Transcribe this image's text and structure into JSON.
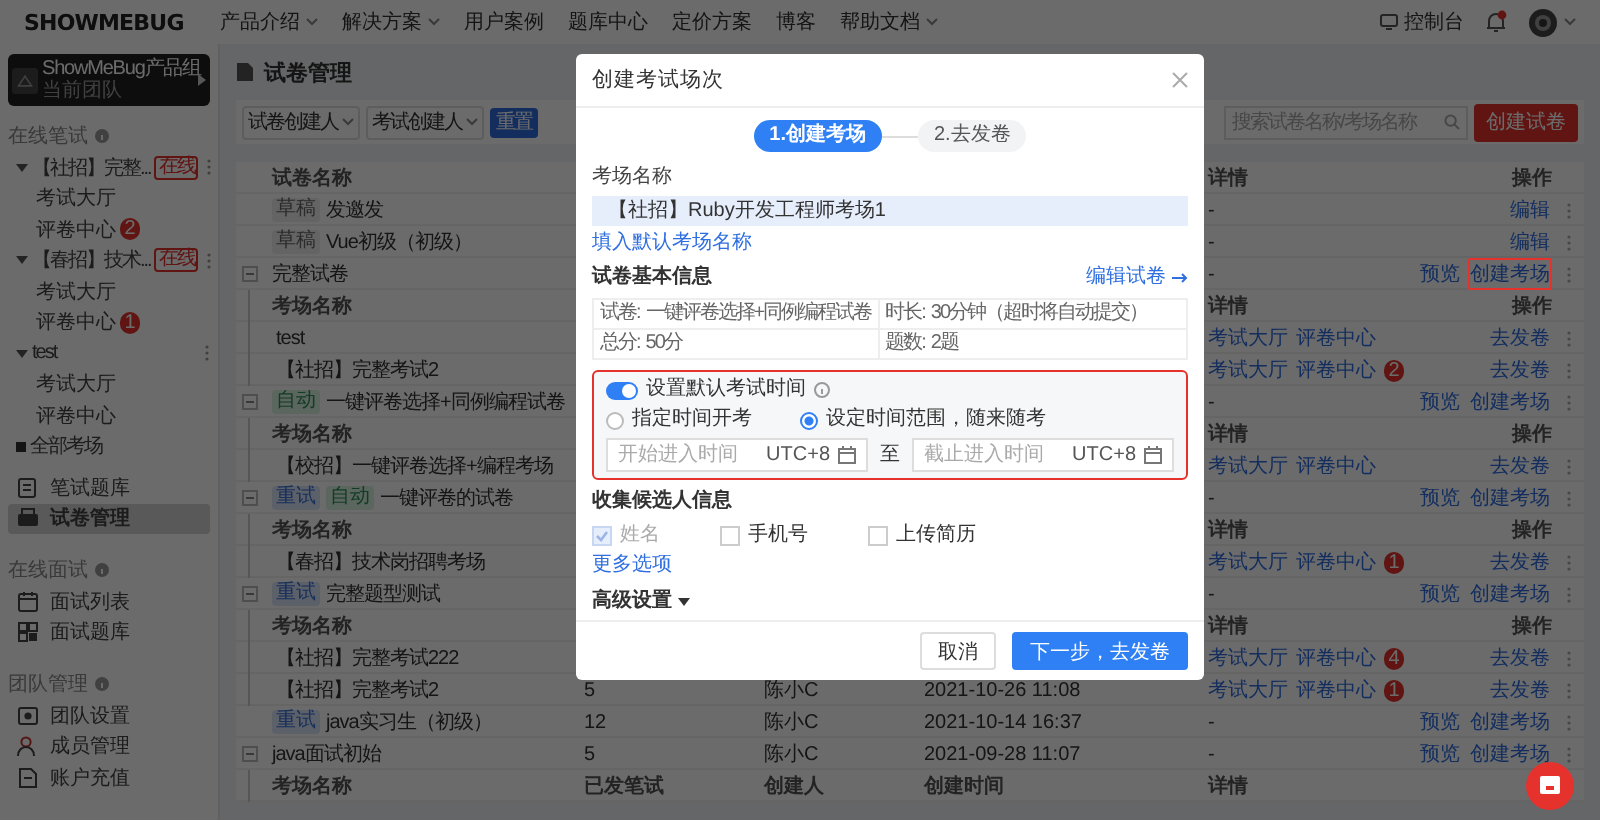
{
  "topbar": {
    "logo": "SHOWMEBUG",
    "nav": [
      {
        "label": "产品介绍",
        "dropdown": true
      },
      {
        "label": "解决方案",
        "dropdown": true
      },
      {
        "label": "用户案例",
        "dropdown": false
      },
      {
        "label": "题库中心",
        "dropdown": false
      },
      {
        "label": "定价方案",
        "dropdown": false
      },
      {
        "label": "博客",
        "dropdown": false
      },
      {
        "label": "帮助文档",
        "dropdown": true
      }
    ],
    "console": "控制台"
  },
  "sidebar": {
    "team": {
      "name": "ShowMeBug产品组",
      "subtitle": "当前团队"
    },
    "items": [
      {
        "kind": "heading",
        "label": "在线笔试"
      },
      {
        "kind": "group",
        "label": "【社招】完整...",
        "badge": "在线",
        "expanded": true,
        "children": [
          {
            "label": "考试大厅"
          },
          {
            "label": "评卷中心",
            "count": "2"
          }
        ]
      },
      {
        "kind": "group",
        "label": "【春招】技术...",
        "badge": "在线",
        "expanded": true,
        "children": [
          {
            "label": "考试大厅"
          },
          {
            "label": "评卷中心",
            "count": "1"
          }
        ]
      },
      {
        "kind": "group",
        "label": "test",
        "expanded": true,
        "children": [
          {
            "label": "考试大厅"
          },
          {
            "label": "评卷中心"
          }
        ]
      },
      {
        "kind": "all",
        "label": "全部考场"
      },
      {
        "kind": "nav",
        "label": "笔试题库",
        "selected": false
      },
      {
        "kind": "nav",
        "label": "试卷管理",
        "selected": true
      },
      {
        "kind": "heading",
        "label": "在线面试"
      },
      {
        "kind": "nav",
        "label": "面试列表",
        "selected": false
      },
      {
        "kind": "nav",
        "label": "面试题库",
        "selected": false
      },
      {
        "kind": "heading",
        "label": "团队管理"
      },
      {
        "kind": "nav",
        "label": "团队设置",
        "selected": false
      },
      {
        "kind": "nav",
        "label": "成员管理",
        "selected": false
      },
      {
        "kind": "nav",
        "label": "账户充值",
        "selected": false
      }
    ]
  },
  "main": {
    "title": "试卷管理",
    "filters": [
      "试卷创建人",
      "考试创建人"
    ],
    "reset": "重置",
    "search": {
      "placeholder": "搜索试卷名称/考场名称"
    },
    "create": "创建试卷",
    "table": {
      "header": {
        "name": "试卷名称",
        "detail": "详情",
        "action": "操作"
      },
      "rows": [
        {
          "kind": "paper",
          "tags": [
            {
              "label": "草稿",
              "kind": "draft"
            }
          ],
          "name": "发邀发",
          "collapsible": false,
          "detail": "-",
          "actions": [
            {
              "label": "编辑",
              "highlighted": false
            }
          ]
        },
        {
          "kind": "paper",
          "tags": [
            {
              "label": "草稿",
              "kind": "draft"
            }
          ],
          "name": "Vue初级（初级）",
          "collapsible": false,
          "detail": "-",
          "actions": [
            {
              "label": "编辑",
              "highlighted": false
            }
          ]
        },
        {
          "kind": "paper",
          "tags": [],
          "name": "完整试卷",
          "collapsible": true,
          "detail": "-",
          "actions": [
            {
              "label": "预览",
              "highlighted": false
            },
            {
              "label": "创建考场",
              "highlighted": true
            }
          ]
        },
        {
          "kind": "header",
          "name": "考场名称",
          "detail": "详情",
          "action": "操作"
        },
        {
          "kind": "exam",
          "name": "test",
          "links": [
            "考试大厅",
            "评卷中心"
          ],
          "actions": [
            {
              "label": "去发卷",
              "highlighted": false
            }
          ]
        },
        {
          "kind": "exam",
          "name": "【社招】完整考试2",
          "links": [
            "考试大厅",
            "评卷中心"
          ],
          "count": "2",
          "actions": [
            {
              "label": "去发卷",
              "highlighted": false
            }
          ]
        },
        {
          "kind": "paper",
          "tags": [
            {
              "label": "自动",
              "kind": "auto"
            }
          ],
          "name": "一键评卷选择+同例编程试卷",
          "collapsible": true,
          "detail": "-",
          "actions": [
            {
              "label": "预览",
              "highlighted": false
            },
            {
              "label": "创建考场",
              "highlighted": false
            }
          ]
        },
        {
          "kind": "header",
          "name": "考场名称",
          "detail": "详情",
          "action": "操作"
        },
        {
          "kind": "exam",
          "name": "【校招】一键评卷选择+编程考场",
          "links": [
            "考试大厅",
            "评卷中心"
          ],
          "actions": [
            {
              "label": "去发卷",
              "highlighted": false
            }
          ]
        },
        {
          "kind": "paper",
          "tags": [
            {
              "label": "重试",
              "kind": "retry"
            },
            {
              "label": "自动",
              "kind": "auto"
            }
          ],
          "name": "一键评卷的试卷",
          "collapsible": true,
          "detail": "-",
          "actions": [
            {
              "label": "预览",
              "highlighted": false
            },
            {
              "label": "创建考场",
              "highlighted": false
            }
          ]
        },
        {
          "kind": "header",
          "name": "考场名称",
          "detail": "详情",
          "action": "操作"
        },
        {
          "kind": "exam",
          "name": "【春招】技术岗招聘考场",
          "links": [
            "考试大厅",
            "评卷中心"
          ],
          "count": "1",
          "actions": [
            {
              "label": "去发卷",
              "highlighted": false
            }
          ]
        },
        {
          "kind": "paper",
          "tags": [
            {
              "label": "重试",
              "kind": "retry"
            }
          ],
          "name": "完整题型测试",
          "collapsible": true,
          "detail": "-",
          "actions": [
            {
              "label": "预览",
              "highlighted": false
            },
            {
              "label": "创建考场",
              "highlighted": false
            }
          ]
        },
        {
          "kind": "header",
          "name": "考场名称",
          "detail": "详情",
          "action": "操作"
        },
        {
          "kind": "exam",
          "name": "【社招】完整考试222",
          "links": [
            "考试大厅",
            "评卷中心"
          ],
          "count": "4",
          "actions": [
            {
              "label": "去发卷",
              "highlighted": false
            }
          ]
        },
        {
          "kind": "exam",
          "name": "【社招】完整考试2",
          "cells": [
            "5",
            "陈小C",
            "2021-10-26 11:08"
          ],
          "links": [
            "考试大厅",
            "评卷中心"
          ],
          "count": "1",
          "actions": [
            {
              "label": "去发卷",
              "highlighted": false
            }
          ]
        },
        {
          "kind": "paper",
          "tags": [
            {
              "label": "重试",
              "kind": "retry"
            }
          ],
          "name": "java实习生（初级）",
          "collapsible": false,
          "cells": [
            "12",
            "陈小C",
            "2021-10-14 16:37"
          ],
          "detail": "-",
          "actions": [
            {
              "label": "预览",
              "highlighted": false
            },
            {
              "label": "创建考场",
              "highlighted": false
            }
          ]
        },
        {
          "kind": "paper",
          "tags": [],
          "name": "java面试初始",
          "collapsible": true,
          "cells": [
            "5",
            "陈小C",
            "2021-09-28 11:07"
          ],
          "detail": "-",
          "actions": [
            {
              "label": "预览",
              "highlighted": false
            },
            {
              "label": "创建考场",
              "highlighted": false
            }
          ]
        },
        {
          "kind": "header",
          "name": "考场名称",
          "columns": [
            "已发笔试",
            "创建人",
            "创建时间"
          ],
          "detail": "详情"
        }
      ]
    }
  },
  "modal": {
    "title": "创建考试场次",
    "steps": [
      {
        "label": "1.创建考场",
        "selected": true
      },
      {
        "label": "2.去发卷",
        "selected": false
      }
    ],
    "name_label": "考场名称",
    "name_value": "【社招】Ruby开发工程师考场1",
    "default_name_link": "填入默认考场名称",
    "paper_section": "试卷基本信息",
    "edit_link": "编辑试卷",
    "info": [
      {
        "label": "试卷:",
        "value": "一键评卷选择+同例编程试卷"
      },
      {
        "label": "时长:",
        "value": "30分钟（超时将自动提交）"
      },
      {
        "label": "总分:",
        "value": "50分"
      },
      {
        "label": "题数:",
        "value": "2题"
      }
    ],
    "time": {
      "highlighted": true,
      "toggle_label": "设置默认考试时间",
      "on": true,
      "modes": [
        {
          "label": "指定时间开考",
          "selected": false
        },
        {
          "label": "设定时间范围，随来随考",
          "selected": true
        }
      ],
      "start_placeholder": "开始进入时间",
      "start_timezone": "UTC+8",
      "separator": "至",
      "end_placeholder": "截止进入时间",
      "end_timezone": "UTC+8"
    },
    "collect_title": "收集候选人信息",
    "fields": [
      {
        "label": "姓名",
        "checked": true,
        "disabled": true
      },
      {
        "label": "手机号",
        "checked": false,
        "disabled": false
      },
      {
        "label": "上传简历",
        "checked": false,
        "disabled": false
      }
    ],
    "more_link": "更多选项",
    "advanced": "高级设置",
    "cancel": "取消",
    "next": "下一步，去发卷"
  }
}
